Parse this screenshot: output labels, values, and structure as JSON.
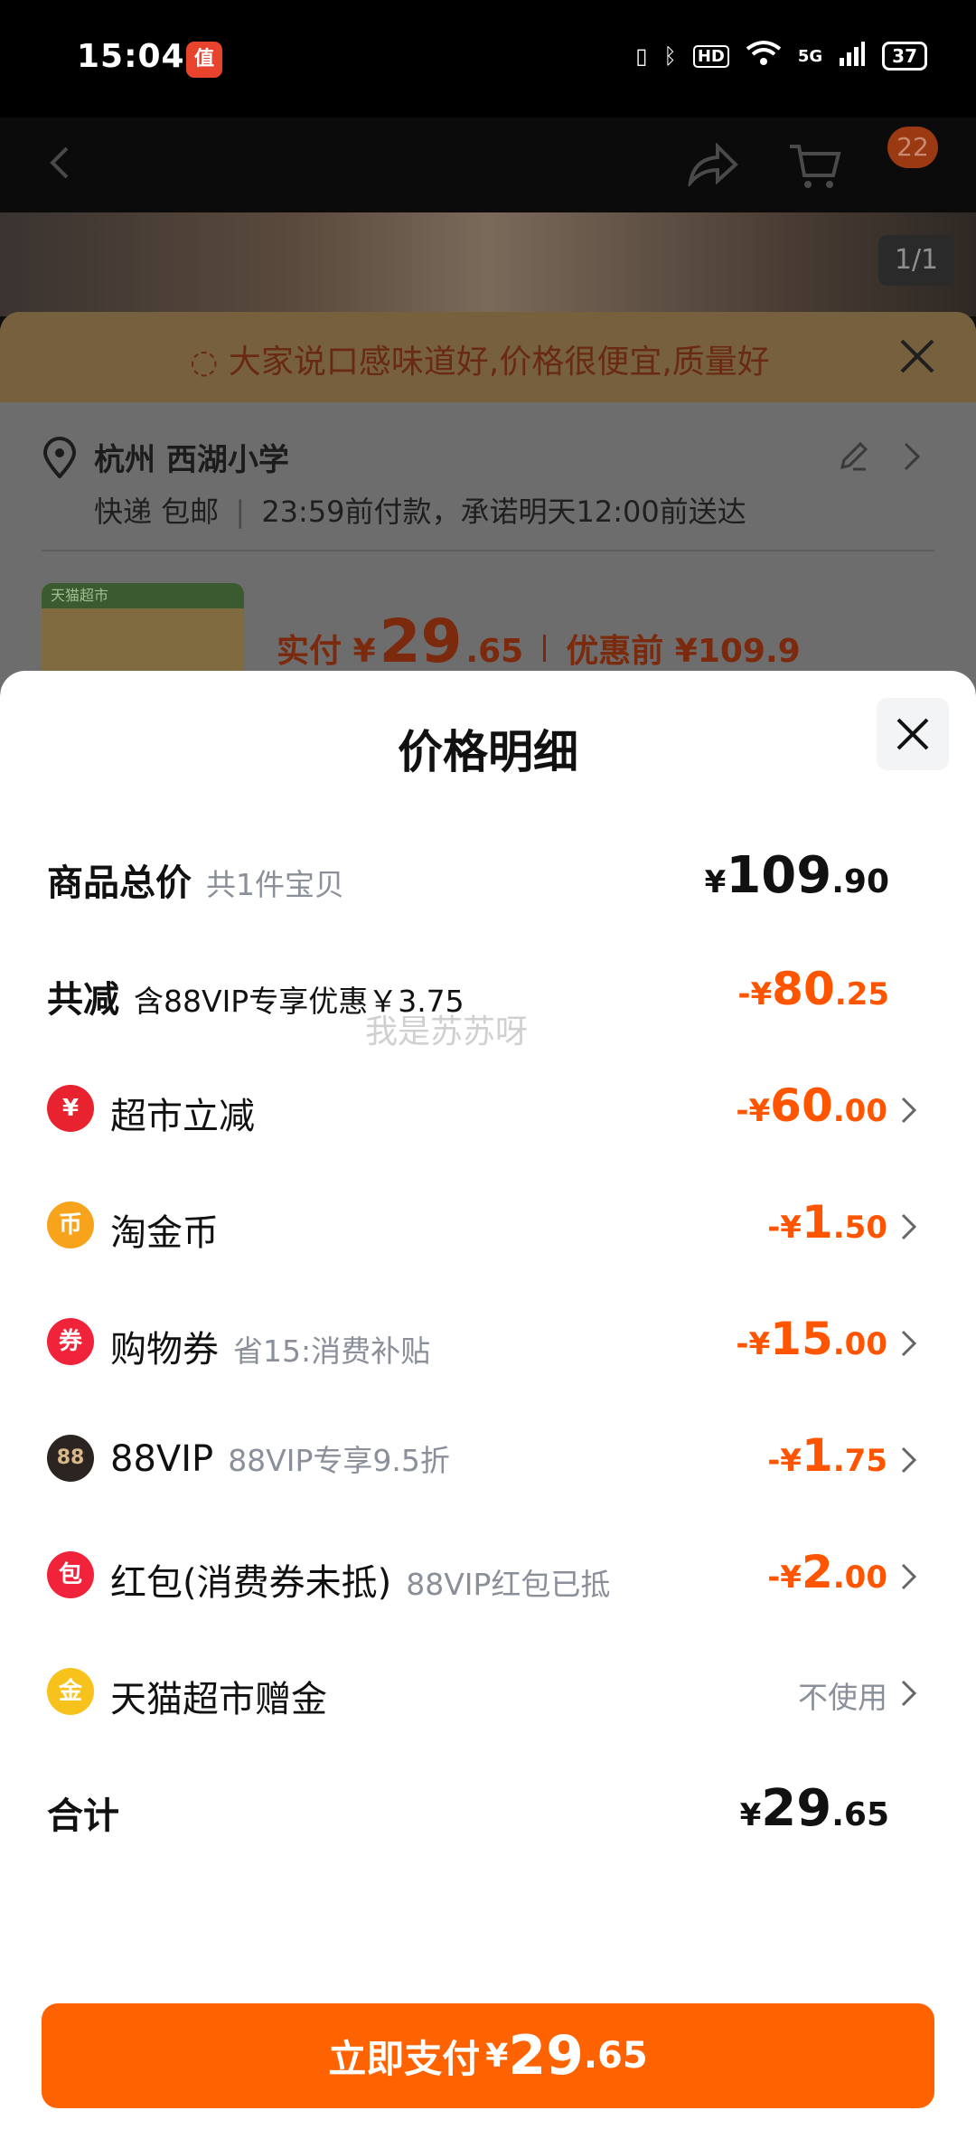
{
  "status_bar": {
    "time": "15:04",
    "app_badge": "值",
    "network": "5G",
    "battery": "37",
    "hd": "HD"
  },
  "nav": {
    "cart_count": "22"
  },
  "gallery": {
    "pager": "1/1"
  },
  "order": {
    "banner": "大家说口感味道好,价格很便宜,质量好",
    "address_title": "杭州 西湖小学",
    "delivery_method": "快递 包邮",
    "delivery_note": "23:59前付款，承诺明天12:00前送达",
    "product_tag": "天猫超市",
    "paid_label": "实付 ¥",
    "paid_int": "29",
    "paid_dec": ".65",
    "before_label": "优惠前 ¥109.9"
  },
  "sheet": {
    "title": "价格明细",
    "watermark": "我是苏苏呀",
    "total_price": {
      "label": "商品总价",
      "sub": "共1件宝贝",
      "cur": "¥",
      "int": "109",
      "dec": ".90"
    },
    "discount": {
      "label": "共减",
      "sub": "含88VIP专享优惠￥3.75",
      "cur": "-¥",
      "int": "80",
      "dec": ".25"
    },
    "items": [
      {
        "icon": "¥",
        "label": "超市立减",
        "sub": "",
        "cur": "-¥",
        "int": "60",
        "dec": ".00",
        "color": "#e8232f"
      },
      {
        "icon": "币",
        "label": "淘金币",
        "sub": "",
        "cur": "-¥",
        "int": "1",
        "dec": ".50",
        "color": "#f7a41c"
      },
      {
        "icon": "券",
        "label": "购物券",
        "sub": "省15:消费补贴",
        "cur": "-¥",
        "int": "15",
        "dec": ".00",
        "color": "#f0233a"
      },
      {
        "icon": "88",
        "label": "88VIP",
        "sub": "88VIP专享9.5折",
        "cur": "-¥",
        "int": "1",
        "dec": ".75",
        "color": "#2b2420"
      },
      {
        "icon": "包",
        "label": "红包(消费券未抵)",
        "sub": "88VIP红包已抵",
        "cur": "-¥",
        "int": "2",
        "dec": ".00",
        "color": "#f0233a"
      }
    ],
    "gift": {
      "icon": "金",
      "label": "天猫超市赠金",
      "value": "不使用",
      "color": "#f7c21c"
    },
    "sum": {
      "label": "合计",
      "cur": "¥",
      "int": "29",
      "dec": ".65"
    },
    "pay_button": {
      "label": "立即支付",
      "cur": "¥",
      "int": "29",
      "dec": ".65"
    }
  }
}
